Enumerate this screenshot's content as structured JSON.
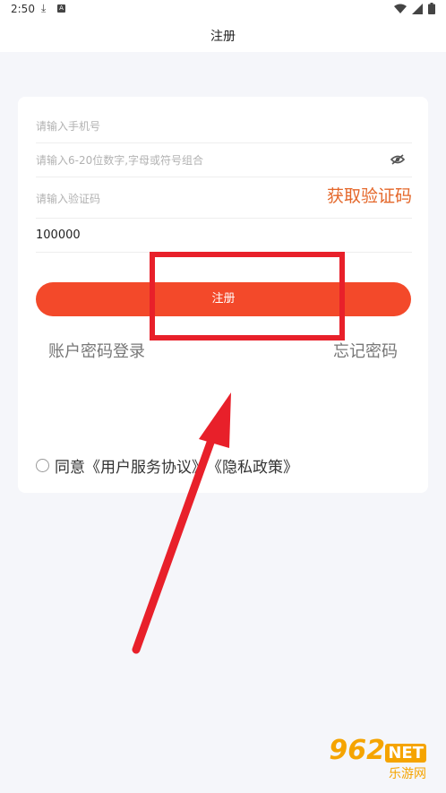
{
  "status_bar": {
    "time": "2:50",
    "download_icon": "download-icon",
    "app_icon": "A",
    "wifi_icon": "wifi-icon",
    "signal_icon": "signal-icon",
    "battery_icon": "battery-icon"
  },
  "app_bar": {
    "title": "注册"
  },
  "form": {
    "phone_placeholder": "请输入手机号",
    "password_placeholder": "请输入6-20位数字,字母或符号组合",
    "code_placeholder": "请输入验证码",
    "get_code_label": "获取验证码",
    "invite_value": "100000"
  },
  "actions": {
    "register_label": "注册",
    "account_login_label": "账户密码登录",
    "forgot_password_label": "忘记密码"
  },
  "agreement": {
    "prefix": "同意",
    "user_agreement": "《用户服务协议》",
    "privacy_policy": "《隐私政策》"
  },
  "watermark": {
    "brand": "962",
    "net": "NET",
    "sub": "乐游网"
  },
  "colors": {
    "accent": "#f3492a",
    "code_link": "#e4672a",
    "annotation": "#e8202a"
  }
}
